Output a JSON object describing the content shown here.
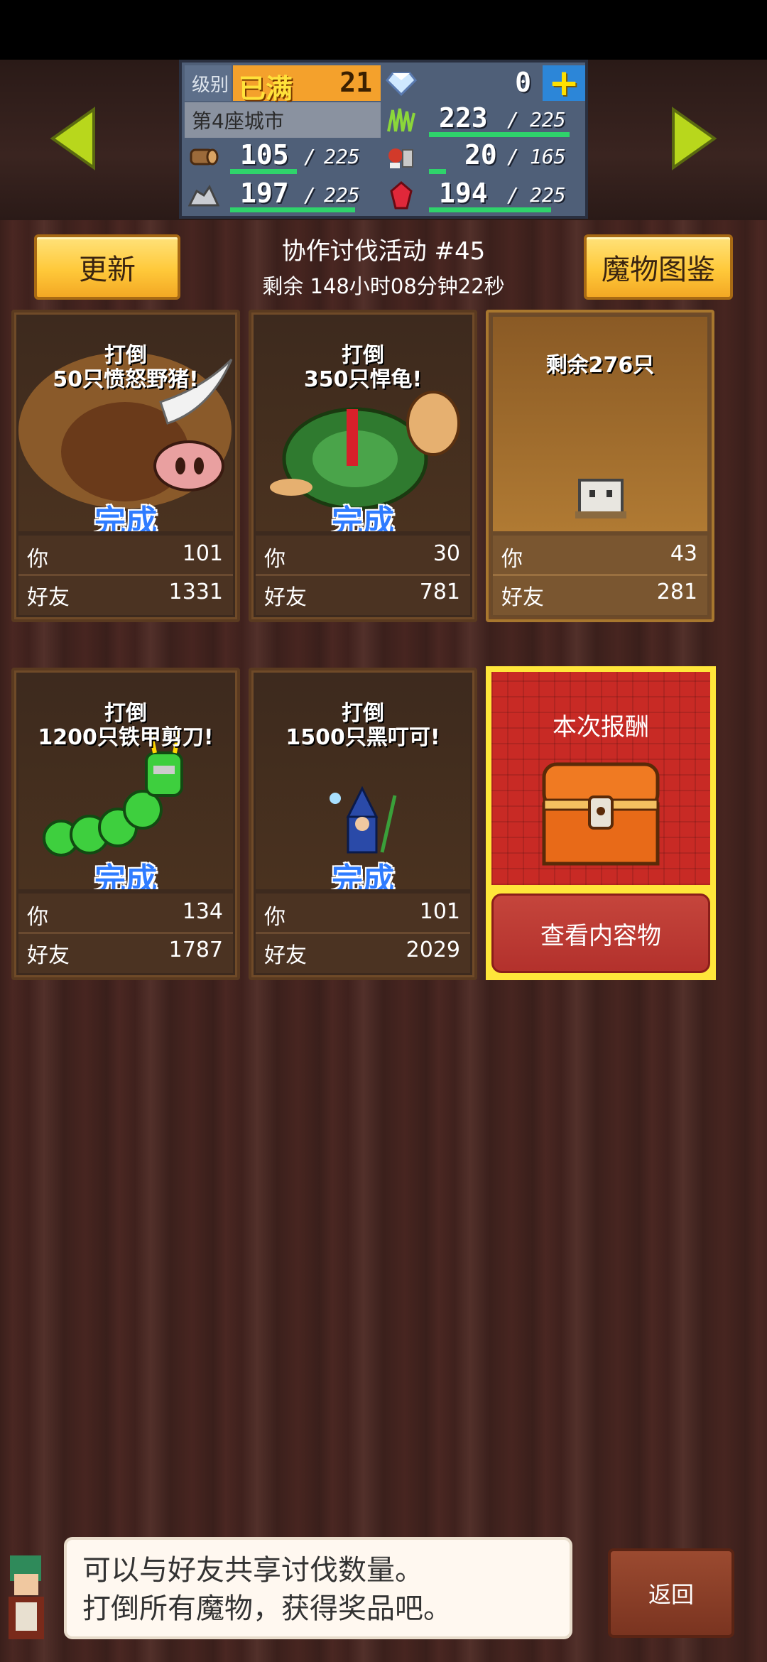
{
  "hud": {
    "level_label": "级别",
    "level_status": "已满",
    "level_value": "21",
    "gems_value": "0",
    "city_label": "第4座城市",
    "grass_value": "223",
    "grass_max": "225",
    "grass_fill": 0.99,
    "wood_value": "105",
    "wood_max": "225",
    "wood_fill": 0.47,
    "food_value": "20",
    "food_max": "165",
    "food_fill": 0.12,
    "ore_value": "197",
    "ore_max": "225",
    "ore_fill": 0.88,
    "crystal_value": "194",
    "crystal_max": "225",
    "crystal_fill": 0.86,
    "slash": "/",
    "plus_label": "+"
  },
  "header": {
    "update_label": "更新",
    "title": "协作讨伐活动 #45",
    "time_remaining": "剩余 148小时08分钟22秒",
    "bestiary_label": "魔物图鉴"
  },
  "cards": [
    {
      "line1": "打倒",
      "line2": "50只愤怒野猪!",
      "status": "完成",
      "you_label": "你",
      "you": "101",
      "friend_label": "好友",
      "friend": "1331"
    },
    {
      "line1": "打倒",
      "line2": "350只悍龟!",
      "status": "完成",
      "you_label": "你",
      "you": "30",
      "friend_label": "好友",
      "friend": "781"
    },
    {
      "line1": "剩余276只",
      "line2": "",
      "status": "",
      "you_label": "你",
      "you": "43",
      "friend_label": "好友",
      "friend": "281"
    },
    {
      "line1": "打倒",
      "line2": "1200只铁甲剪刀!",
      "status": "完成",
      "you_label": "你",
      "you": "134",
      "friend_label": "好友",
      "friend": "1787"
    },
    {
      "line1": "打倒",
      "line2": "1500只黑叮可!",
      "status": "完成",
      "you_label": "你",
      "you": "101",
      "friend_label": "好友",
      "friend": "2029"
    }
  ],
  "reward": {
    "title": "本次报酬",
    "view_label": "查看内容物"
  },
  "footer": {
    "tip_line1": "可以与好友共享讨伐数量。",
    "tip_line2": "打倒所有魔物，获得奖品吧。",
    "back_label": "返回"
  },
  "colors": {
    "accent_yellow": "#ffc93a",
    "bar_green": "#2fd36b",
    "done_blue": "#2f7cff",
    "reward_red": "#c82a25"
  }
}
